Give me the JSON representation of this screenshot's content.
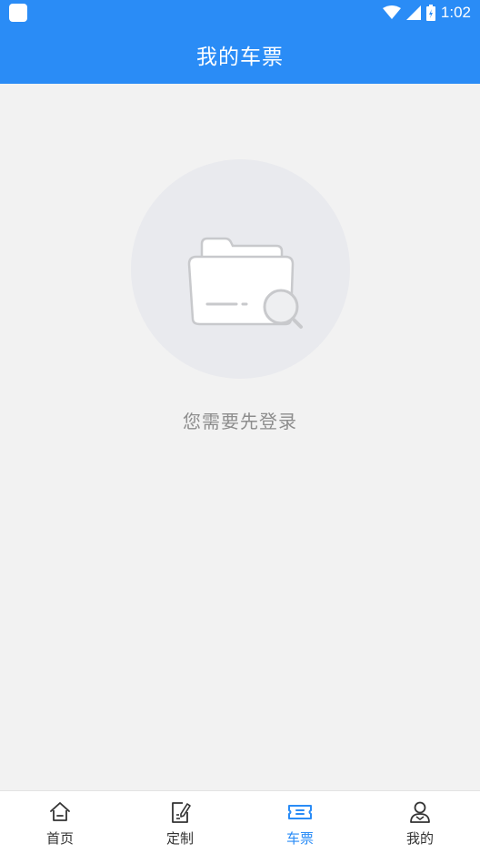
{
  "status_bar": {
    "time": "1:02",
    "icons": [
      "app-notification-icon",
      "wifi-icon",
      "signal-icon",
      "battery-icon"
    ]
  },
  "header": {
    "title": "我的车票",
    "background_color": "#2a8cf6"
  },
  "empty_state": {
    "illustration": "folder-search-icon",
    "message": "您需要先登录"
  },
  "tabbar": {
    "active_color": "#2a8cf6",
    "tabs": [
      {
        "label": "首页",
        "icon": "home-icon",
        "active": false
      },
      {
        "label": "定制",
        "icon": "edit-document-icon",
        "active": false
      },
      {
        "label": "车票",
        "icon": "ticket-icon",
        "active": true
      },
      {
        "label": "我的",
        "icon": "user-icon",
        "active": false
      }
    ]
  }
}
